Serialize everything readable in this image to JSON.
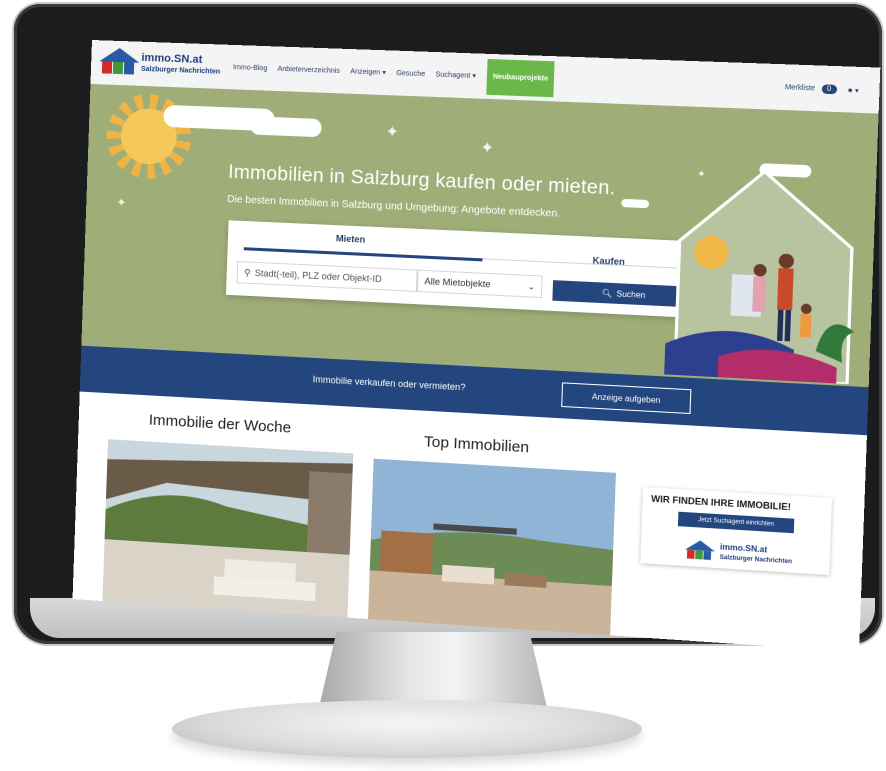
{
  "logo": {
    "line1": "immo.SN.at",
    "line2": "Salzburger Nachrichten"
  },
  "nav": {
    "items": [
      "Immo-Blog",
      "Anbieterverzeichnis",
      "Anzeigen ▾",
      "Gesuche",
      "Suchagent ▾",
      "Neubauprojekte"
    ],
    "merkliste_label": "Merkliste",
    "merkliste_count": "0",
    "user_menu": "▾"
  },
  "hero": {
    "title": "Immobilien in Salzburg kaufen oder mieten.",
    "subtitle": "Die besten Immobilien in Salzburg und Umgebung: Angebote entdecken.",
    "tabs": [
      "Mieten",
      "Kaufen"
    ],
    "location_placeholder": "Stadt(-teil), PLZ oder Objekt-ID",
    "type_select": "Alle Mietobjekte",
    "search_button": "Suchen"
  },
  "banner": {
    "text": "Immobilie verkaufen oder vermieten?",
    "button": "Anzeige aufgeben"
  },
  "sections": {
    "woche_title": "Immobilie der Woche",
    "top_title": "Top Immobilien"
  },
  "ad": {
    "title": "WIR FINDEN IHRE IMMOBILIE!",
    "button": "Jetzt Suchagent einrichten",
    "logo_line1": "immo.SN.at",
    "logo_line2": "Salzburger Nachrichten"
  },
  "colors": {
    "brand_blue": "#24467e",
    "green": "#6ab84a",
    "hero_bg": "#9fae78"
  }
}
